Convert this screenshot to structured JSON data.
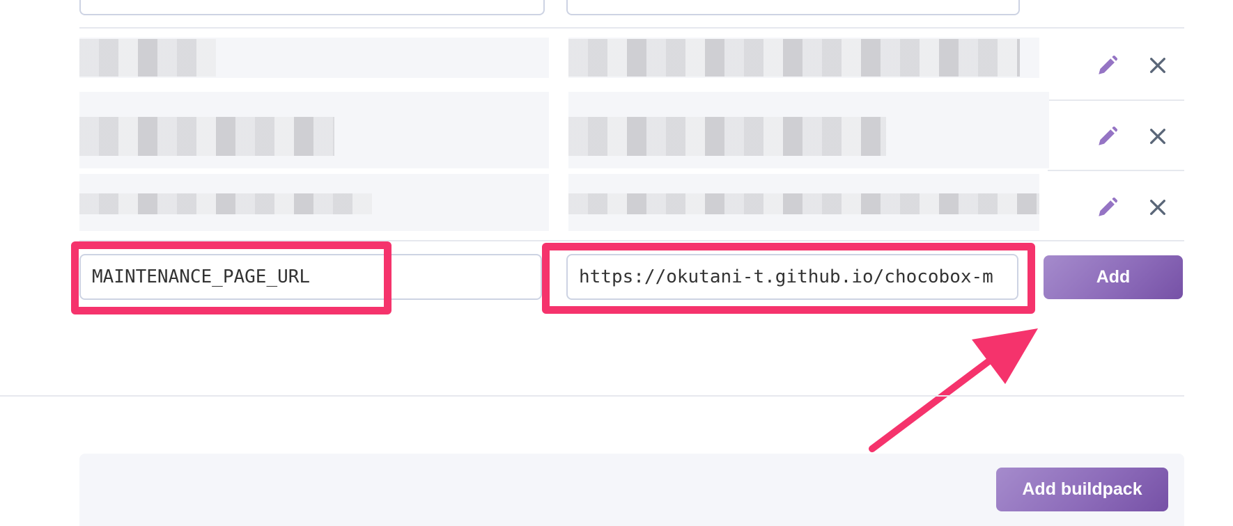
{
  "config_vars": {
    "existing_rows": [
      {
        "key_redacted": true,
        "value_redacted": true,
        "edit_icon": "pencil-icon",
        "delete_icon": "close-icon"
      },
      {
        "key_redacted": true,
        "value_redacted": true,
        "edit_icon": "pencil-icon",
        "delete_icon": "close-icon"
      },
      {
        "key_redacted": true,
        "value_redacted": true,
        "edit_icon": "pencil-icon",
        "delete_icon": "close-icon"
      }
    ],
    "new_row": {
      "key_value": "MAINTENANCE_PAGE_URL",
      "value_value": "https://okutani-t.github.io/chocobox-m",
      "add_label": "Add"
    }
  },
  "buildpacks": {
    "add_label": "Add buildpack"
  },
  "colors": {
    "accent_purple": "#79589f",
    "annotation_pink": "#f5336c",
    "icon_slate": "#5a6678"
  }
}
